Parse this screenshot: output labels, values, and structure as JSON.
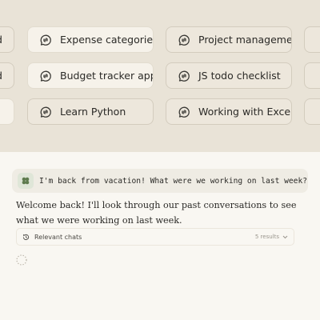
{
  "suggestions": {
    "row1": [
      "d",
      "Expense categories",
      "Project management",
      ""
    ],
    "row2": [
      "d",
      "Budget tracker app",
      "JS todo checklist",
      ""
    ],
    "row3": [
      "",
      "Learn Python",
      "Working with Excel",
      ""
    ]
  },
  "conversation": {
    "user_message": "I'm back from vacation! What were we working on last week?",
    "assistant_reply": "Welcome back! I'll look through our past conversations to see what we were working on last week.",
    "relevant_chats_label": "Relevant chats",
    "relevant_chats_count": "5 results"
  },
  "icons": {
    "chip_icon": "chat-bubble-refresh-icon",
    "avatar_icon": "clover-icon",
    "relevant_icon": "history-icon",
    "expand_icon": "chevron-down-icon",
    "loading_icon": "spinner-icon"
  },
  "colors": {
    "top_background": "#e9e3d7",
    "page_background": "#f9f7f2",
    "avatar_green": "#5e7b4e"
  }
}
